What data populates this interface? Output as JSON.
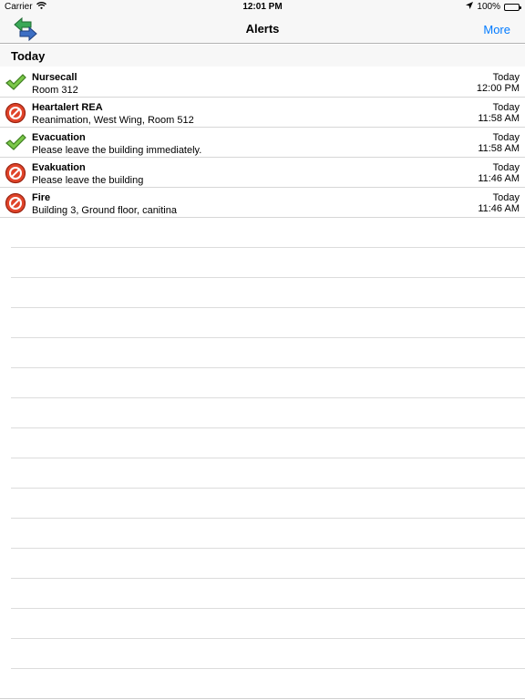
{
  "status_bar": {
    "carrier": "Carrier",
    "time": "12:01 PM",
    "battery": "100%"
  },
  "nav": {
    "title": "Alerts",
    "more_label": "More"
  },
  "section": {
    "title": "Today"
  },
  "alerts": [
    {
      "title": "Nursecall",
      "subtitle": "Room 312",
      "day": "Today",
      "time": "12:00 PM",
      "status": "check-icon"
    },
    {
      "title": "Heartalert REA",
      "subtitle": "Reanimation, West Wing, Room 512",
      "day": "Today",
      "time": "11:58 AM",
      "status": "stop-icon"
    },
    {
      "title": "Evacuation",
      "subtitle": "Please leave the building immediately.",
      "day": "Today",
      "time": "11:58 AM",
      "status": "check-icon"
    },
    {
      "title": "Evakuation",
      "subtitle": "Please leave the building",
      "day": "Today",
      "time": "11:46 AM",
      "status": "stop-icon"
    },
    {
      "title": "Fire",
      "subtitle": "Building 3, Ground floor, canitina",
      "day": "Today",
      "time": "11:46 AM",
      "status": "stop-icon"
    }
  ],
  "colors": {
    "accent": "#007aff",
    "check_green": "#6cbf3a",
    "stop_red": "#d9341f",
    "back_green": "#2e9a4a",
    "back_blue": "#2a5bb0"
  }
}
